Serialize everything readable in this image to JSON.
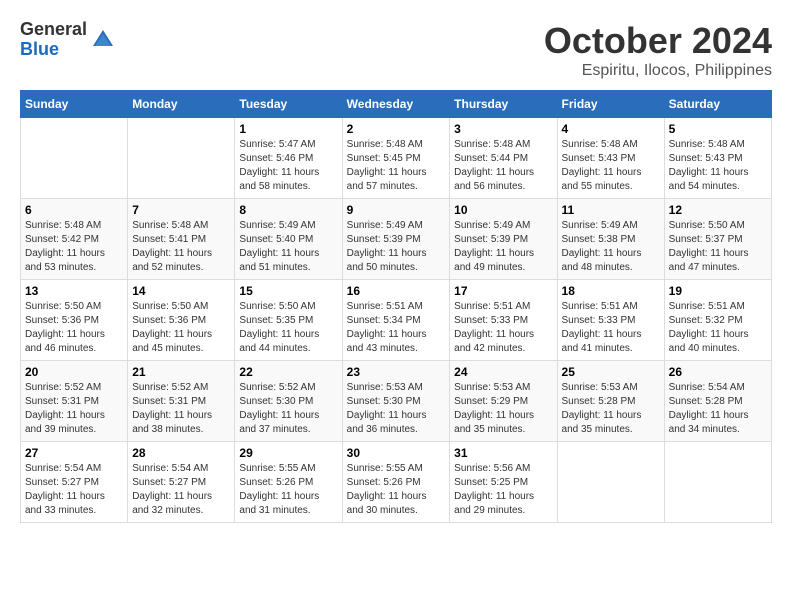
{
  "logo": {
    "general": "General",
    "blue": "Blue"
  },
  "title": "October 2024",
  "location": "Espiritu, Ilocos, Philippines",
  "days_header": [
    "Sunday",
    "Monday",
    "Tuesday",
    "Wednesday",
    "Thursday",
    "Friday",
    "Saturday"
  ],
  "weeks": [
    [
      {
        "day": "",
        "info": ""
      },
      {
        "day": "",
        "info": ""
      },
      {
        "day": "1",
        "sunrise": "Sunrise: 5:47 AM",
        "sunset": "Sunset: 5:46 PM",
        "daylight": "Daylight: 11 hours and 58 minutes."
      },
      {
        "day": "2",
        "sunrise": "Sunrise: 5:48 AM",
        "sunset": "Sunset: 5:45 PM",
        "daylight": "Daylight: 11 hours and 57 minutes."
      },
      {
        "day": "3",
        "sunrise": "Sunrise: 5:48 AM",
        "sunset": "Sunset: 5:44 PM",
        "daylight": "Daylight: 11 hours and 56 minutes."
      },
      {
        "day": "4",
        "sunrise": "Sunrise: 5:48 AM",
        "sunset": "Sunset: 5:43 PM",
        "daylight": "Daylight: 11 hours and 55 minutes."
      },
      {
        "day": "5",
        "sunrise": "Sunrise: 5:48 AM",
        "sunset": "Sunset: 5:43 PM",
        "daylight": "Daylight: 11 hours and 54 minutes."
      }
    ],
    [
      {
        "day": "6",
        "sunrise": "Sunrise: 5:48 AM",
        "sunset": "Sunset: 5:42 PM",
        "daylight": "Daylight: 11 hours and 53 minutes."
      },
      {
        "day": "7",
        "sunrise": "Sunrise: 5:48 AM",
        "sunset": "Sunset: 5:41 PM",
        "daylight": "Daylight: 11 hours and 52 minutes."
      },
      {
        "day": "8",
        "sunrise": "Sunrise: 5:49 AM",
        "sunset": "Sunset: 5:40 PM",
        "daylight": "Daylight: 11 hours and 51 minutes."
      },
      {
        "day": "9",
        "sunrise": "Sunrise: 5:49 AM",
        "sunset": "Sunset: 5:39 PM",
        "daylight": "Daylight: 11 hours and 50 minutes."
      },
      {
        "day": "10",
        "sunrise": "Sunrise: 5:49 AM",
        "sunset": "Sunset: 5:39 PM",
        "daylight": "Daylight: 11 hours and 49 minutes."
      },
      {
        "day": "11",
        "sunrise": "Sunrise: 5:49 AM",
        "sunset": "Sunset: 5:38 PM",
        "daylight": "Daylight: 11 hours and 48 minutes."
      },
      {
        "day": "12",
        "sunrise": "Sunrise: 5:50 AM",
        "sunset": "Sunset: 5:37 PM",
        "daylight": "Daylight: 11 hours and 47 minutes."
      }
    ],
    [
      {
        "day": "13",
        "sunrise": "Sunrise: 5:50 AM",
        "sunset": "Sunset: 5:36 PM",
        "daylight": "Daylight: 11 hours and 46 minutes."
      },
      {
        "day": "14",
        "sunrise": "Sunrise: 5:50 AM",
        "sunset": "Sunset: 5:36 PM",
        "daylight": "Daylight: 11 hours and 45 minutes."
      },
      {
        "day": "15",
        "sunrise": "Sunrise: 5:50 AM",
        "sunset": "Sunset: 5:35 PM",
        "daylight": "Daylight: 11 hours and 44 minutes."
      },
      {
        "day": "16",
        "sunrise": "Sunrise: 5:51 AM",
        "sunset": "Sunset: 5:34 PM",
        "daylight": "Daylight: 11 hours and 43 minutes."
      },
      {
        "day": "17",
        "sunrise": "Sunrise: 5:51 AM",
        "sunset": "Sunset: 5:33 PM",
        "daylight": "Daylight: 11 hours and 42 minutes."
      },
      {
        "day": "18",
        "sunrise": "Sunrise: 5:51 AM",
        "sunset": "Sunset: 5:33 PM",
        "daylight": "Daylight: 11 hours and 41 minutes."
      },
      {
        "day": "19",
        "sunrise": "Sunrise: 5:51 AM",
        "sunset": "Sunset: 5:32 PM",
        "daylight": "Daylight: 11 hours and 40 minutes."
      }
    ],
    [
      {
        "day": "20",
        "sunrise": "Sunrise: 5:52 AM",
        "sunset": "Sunset: 5:31 PM",
        "daylight": "Daylight: 11 hours and 39 minutes."
      },
      {
        "day": "21",
        "sunrise": "Sunrise: 5:52 AM",
        "sunset": "Sunset: 5:31 PM",
        "daylight": "Daylight: 11 hours and 38 minutes."
      },
      {
        "day": "22",
        "sunrise": "Sunrise: 5:52 AM",
        "sunset": "Sunset: 5:30 PM",
        "daylight": "Daylight: 11 hours and 37 minutes."
      },
      {
        "day": "23",
        "sunrise": "Sunrise: 5:53 AM",
        "sunset": "Sunset: 5:30 PM",
        "daylight": "Daylight: 11 hours and 36 minutes."
      },
      {
        "day": "24",
        "sunrise": "Sunrise: 5:53 AM",
        "sunset": "Sunset: 5:29 PM",
        "daylight": "Daylight: 11 hours and 35 minutes."
      },
      {
        "day": "25",
        "sunrise": "Sunrise: 5:53 AM",
        "sunset": "Sunset: 5:28 PM",
        "daylight": "Daylight: 11 hours and 35 minutes."
      },
      {
        "day": "26",
        "sunrise": "Sunrise: 5:54 AM",
        "sunset": "Sunset: 5:28 PM",
        "daylight": "Daylight: 11 hours and 34 minutes."
      }
    ],
    [
      {
        "day": "27",
        "sunrise": "Sunrise: 5:54 AM",
        "sunset": "Sunset: 5:27 PM",
        "daylight": "Daylight: 11 hours and 33 minutes."
      },
      {
        "day": "28",
        "sunrise": "Sunrise: 5:54 AM",
        "sunset": "Sunset: 5:27 PM",
        "daylight": "Daylight: 11 hours and 32 minutes."
      },
      {
        "day": "29",
        "sunrise": "Sunrise: 5:55 AM",
        "sunset": "Sunset: 5:26 PM",
        "daylight": "Daylight: 11 hours and 31 minutes."
      },
      {
        "day": "30",
        "sunrise": "Sunrise: 5:55 AM",
        "sunset": "Sunset: 5:26 PM",
        "daylight": "Daylight: 11 hours and 30 minutes."
      },
      {
        "day": "31",
        "sunrise": "Sunrise: 5:56 AM",
        "sunset": "Sunset: 5:25 PM",
        "daylight": "Daylight: 11 hours and 29 minutes."
      },
      {
        "day": "",
        "info": ""
      },
      {
        "day": "",
        "info": ""
      }
    ]
  ]
}
